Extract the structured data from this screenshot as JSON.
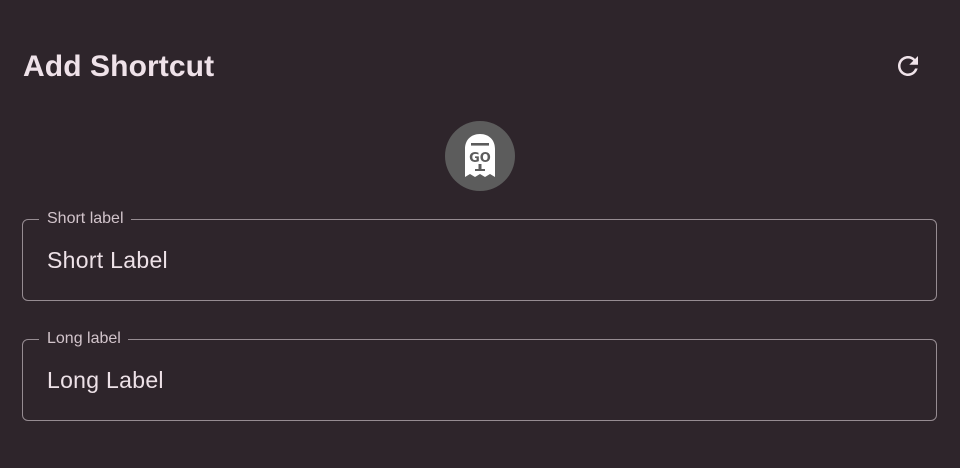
{
  "dialog": {
    "title": "Add Shortcut",
    "refresh_icon": "refresh-icon",
    "app_icon": "ghost-go-icon",
    "app_icon_text": "GO"
  },
  "fields": {
    "short_label": {
      "label": "Short label",
      "value": "Short Label"
    },
    "long_label": {
      "label": "Long label",
      "value": "Long Label"
    }
  },
  "colors": {
    "background": "#2e252b",
    "text": "#efe2e9",
    "outline": "#968c92",
    "avatar": "#5c5c5c"
  }
}
